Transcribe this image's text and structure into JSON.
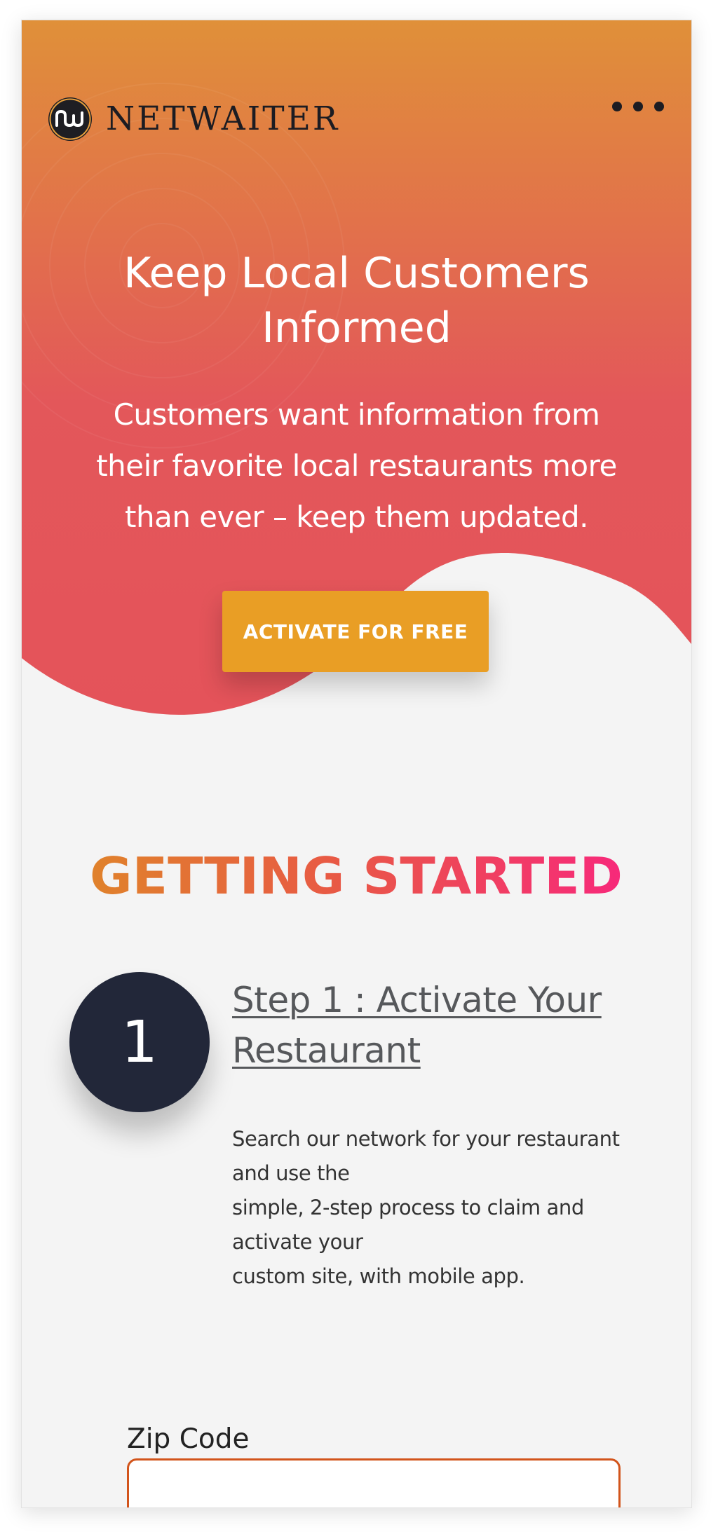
{
  "brand": {
    "name": "NETWAITER",
    "logo_icon": "netwaiter-logo-icon"
  },
  "header": {
    "menu_icon": "more-horizontal-icon"
  },
  "hero": {
    "title": "Keep Local Customers Informed",
    "subtitle_lines": [
      "Customers want information from",
      "their favorite local restaurants more",
      "than ever – keep them updated."
    ],
    "cta_label": "ACTIVATE FOR FREE",
    "gradient_top": "#e09039",
    "gradient_bottom": "#e3555a",
    "cta_color": "#e99e25"
  },
  "getting_started": {
    "heading": "GETTING STARTED",
    "gradient_start": "#e0822b",
    "gradient_end": "#f7297a"
  },
  "step1": {
    "number": "1",
    "title_lines": [
      "Step 1 : Activate Your",
      "Restaurant"
    ],
    "description_lines": [
      "Search our network for your restaurant",
      "and use the",
      "simple, 2-step process to claim and",
      "activate your",
      "custom site, with mobile app."
    ]
  },
  "form": {
    "zip_label": "Zip Code",
    "zip_value": ""
  }
}
